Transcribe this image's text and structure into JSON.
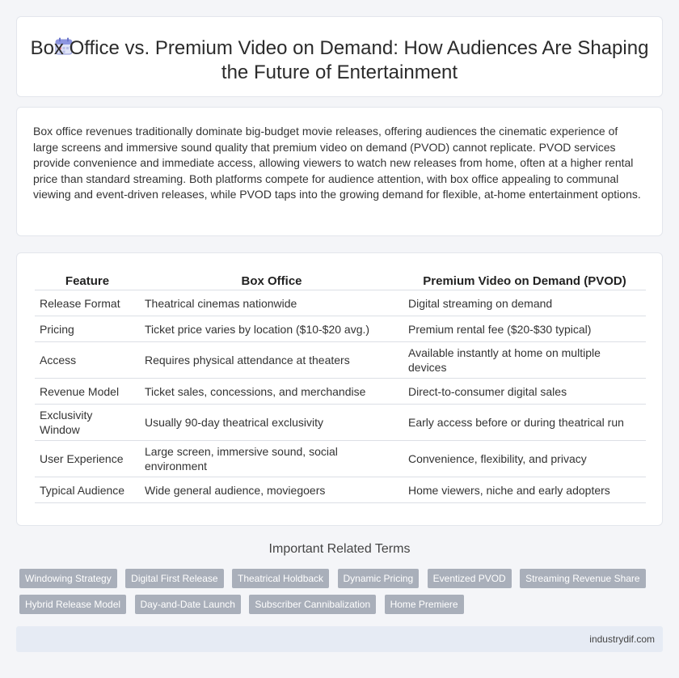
{
  "header": {
    "icon": "calendar-icon",
    "title": "Box Office vs. Premium Video on Demand: How Audiences Are Shaping the Future of Entertainment"
  },
  "intro": "Box office revenues traditionally dominate big-budget movie releases, offering audiences the cinematic experience of large screens and immersive sound quality that premium video on demand (PVOD) cannot replicate. PVOD services provide convenience and immediate access, allowing viewers to watch new releases from home, often at a higher rental price than standard streaming. Both platforms compete for audience attention, with box office appealing to communal viewing and event-driven releases, while PVOD taps into the growing demand for flexible, at-home entertainment options.",
  "table": {
    "headers": [
      "Feature",
      "Box Office",
      "Premium Video on Demand (PVOD)"
    ],
    "rows": [
      [
        "Release Format",
        "Theatrical cinemas nationwide",
        "Digital streaming on demand"
      ],
      [
        "Pricing",
        "Ticket price varies by location ($10-$20 avg.)",
        "Premium rental fee ($20-$30 typical)"
      ],
      [
        "Access",
        "Requires physical attendance at theaters",
        "Available instantly at home on multiple devices"
      ],
      [
        "Revenue Model",
        "Ticket sales, concessions, and merchandise",
        "Direct-to-consumer digital sales"
      ],
      [
        "Exclusivity Window",
        "Usually 90-day theatrical exclusivity",
        "Early access before or during theatrical run"
      ],
      [
        "User Experience",
        "Large screen, immersive sound, social environment",
        "Convenience, flexibility, and privacy"
      ],
      [
        "Typical Audience",
        "Wide general audience, moviegoers",
        "Home viewers, niche and early adopters"
      ]
    ]
  },
  "related": {
    "title": "Important Related Terms",
    "tags": [
      "Windowing Strategy",
      "Digital First Release",
      "Theatrical Holdback",
      "Dynamic Pricing",
      "Eventized PVOD",
      "Streaming Revenue Share",
      "Hybrid Release Model",
      "Day-and-Date Launch",
      "Subscriber Cannibalization",
      "Home Premiere"
    ]
  },
  "footer": {
    "site": "industrydif.com"
  }
}
